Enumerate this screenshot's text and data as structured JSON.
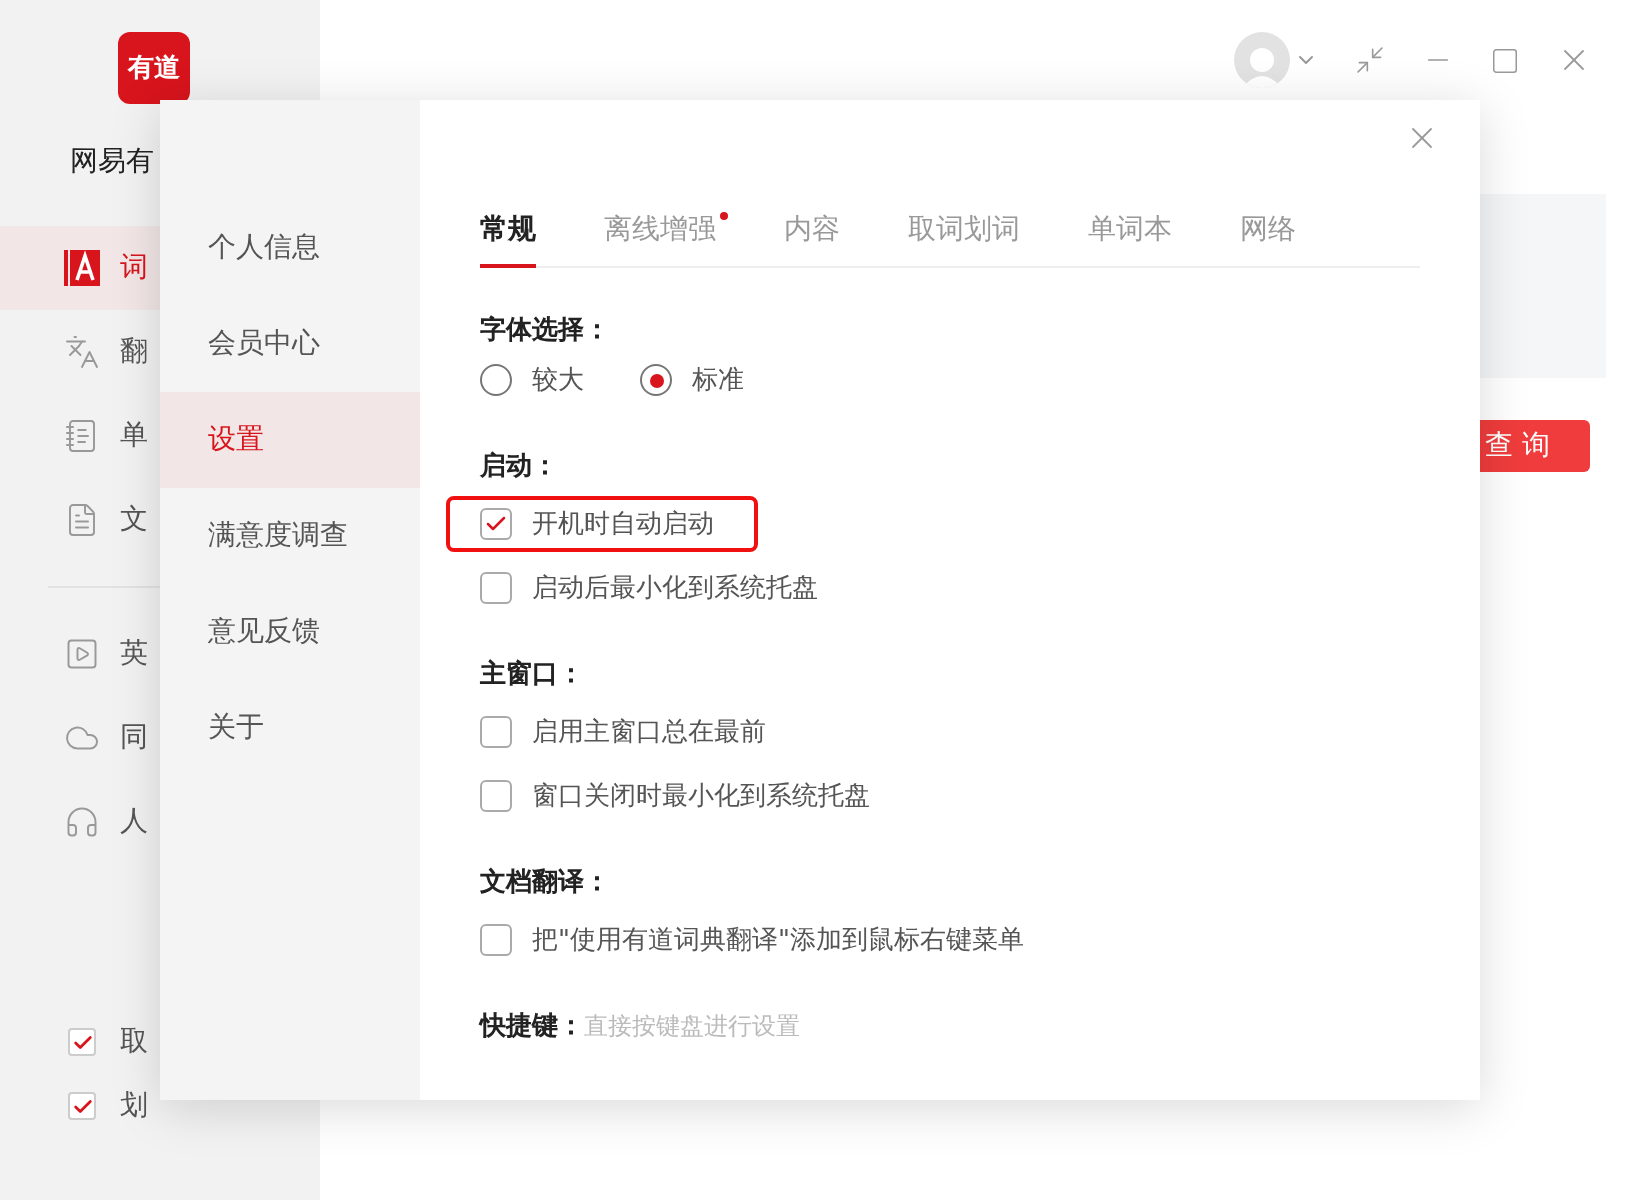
{
  "app": {
    "logo": "有道",
    "name": "网易有",
    "nav_main": [
      {
        "label": "词",
        "selected": true
      },
      {
        "label": "翻",
        "selected": false
      },
      {
        "label": "单",
        "selected": false
      },
      {
        "label": "文",
        "selected": false
      }
    ],
    "nav_more": [
      {
        "label": "英",
        "selected": false
      },
      {
        "label": "同",
        "selected": false
      },
      {
        "label": "人",
        "selected": false
      }
    ],
    "options": [
      {
        "label": "取",
        "checked": true
      },
      {
        "label": "划",
        "checked": true
      }
    ],
    "search_button": "查 询"
  },
  "dialog": {
    "menu": [
      {
        "label": "个人信息",
        "selected": false
      },
      {
        "label": "会员中心",
        "selected": false
      },
      {
        "label": "设置",
        "selected": true
      },
      {
        "label": "满意度调查",
        "selected": false
      },
      {
        "label": "意见反馈",
        "selected": false
      },
      {
        "label": "关于",
        "selected": false
      }
    ],
    "tabs": [
      {
        "label": "常规",
        "selected": true,
        "dot": false
      },
      {
        "label": "离线增强",
        "selected": false,
        "dot": true
      },
      {
        "label": "内容",
        "selected": false,
        "dot": false
      },
      {
        "label": "取词划词",
        "selected": false,
        "dot": false
      },
      {
        "label": "单词本",
        "selected": false,
        "dot": false
      },
      {
        "label": "网络",
        "selected": false,
        "dot": false
      }
    ],
    "sections": [
      {
        "title": "字体选择：",
        "kind": "radio",
        "options": [
          {
            "label": "较大",
            "selected": false
          },
          {
            "label": "标准",
            "selected": true
          }
        ]
      },
      {
        "title": "启动：",
        "kind": "checkbox",
        "options": [
          {
            "label": "开机时自动启动",
            "checked": true,
            "highlighted": true
          },
          {
            "label": "启动后最小化到系统托盘",
            "checked": false,
            "highlighted": false
          }
        ]
      },
      {
        "title": "主窗口：",
        "kind": "checkbox",
        "options": [
          {
            "label": "启用主窗口总在最前",
            "checked": false,
            "highlighted": false
          },
          {
            "label": "窗口关闭时最小化到系统托盘",
            "checked": false,
            "highlighted": false
          }
        ]
      },
      {
        "title": "文档翻译：",
        "kind": "checkbox",
        "options": [
          {
            "label": "把\"使用有道词典翻译\"添加到鼠标右键菜单",
            "checked": false,
            "highlighted": false
          }
        ]
      },
      {
        "title": "快捷键：",
        "kind": "hint",
        "hint": "直接按键盘进行设置"
      }
    ]
  }
}
